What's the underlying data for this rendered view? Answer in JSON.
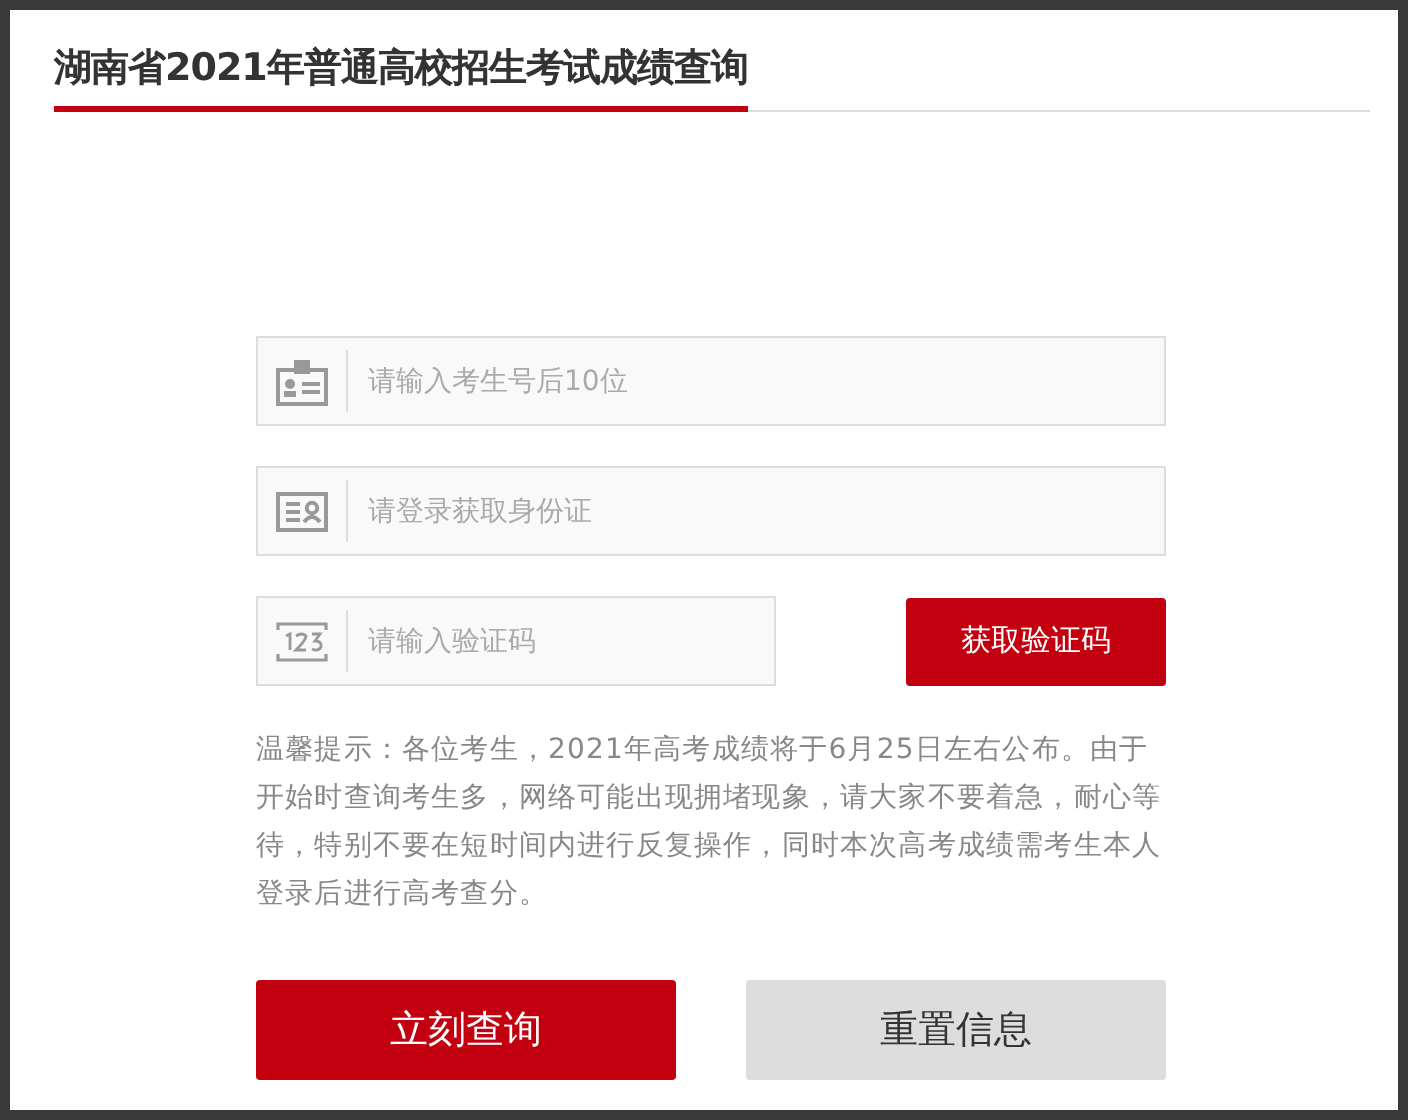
{
  "title": "湖南省2021年普通高校招生考试成绩查询",
  "fields": [
    {
      "kind": "candidate",
      "placeholder": "请输入考生号后10位"
    },
    {
      "kind": "idcard",
      "placeholder": "请登录获取身份证"
    },
    {
      "kind": "code",
      "placeholder": "请输入验证码",
      "button": "获取验证码"
    }
  ],
  "notice": "温馨提示：各位考生，2021年高考成绩将于6月25日左右公布。由于开始时查询考生多，网络可能出现拥堵现象，请大家不要着急，耐心等待，特别不要在短时间内进行反复操作，同时本次高考成绩需考生本人登录后进行高考查分。",
  "buttons": [
    {
      "kind": "primary",
      "label": "立刻查询"
    },
    {
      "kind": "secondary",
      "label": "重置信息"
    }
  ]
}
